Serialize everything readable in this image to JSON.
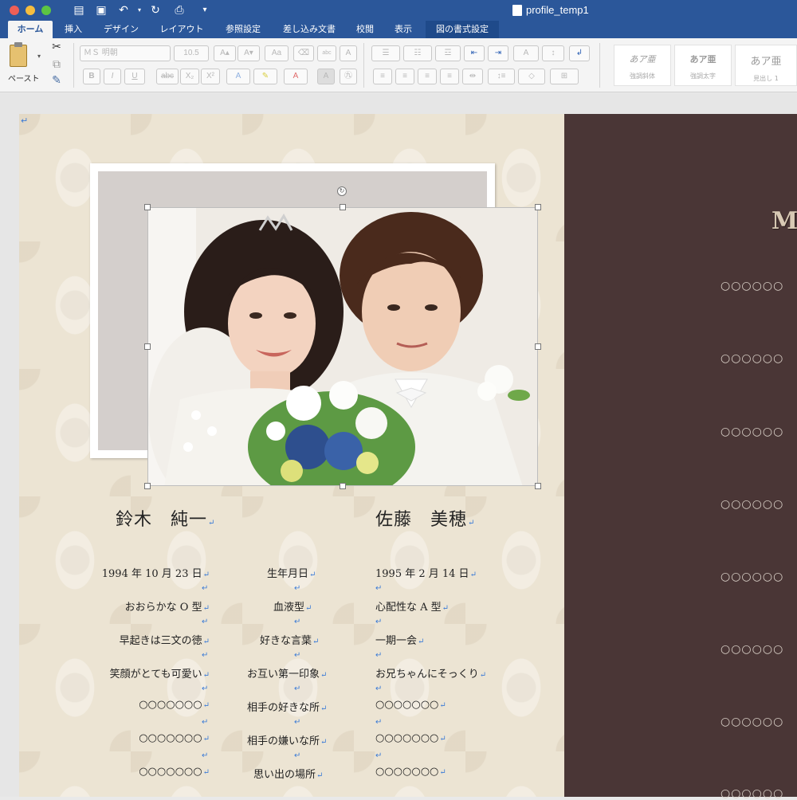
{
  "window": {
    "title": "profile_temp1"
  },
  "tabs": [
    "ホーム",
    "挿入",
    "デザイン",
    "レイアウト",
    "参照設定",
    "差し込み文書",
    "校閲",
    "表示",
    "図の書式設定"
  ],
  "ribbon": {
    "paste_label": "ペースト",
    "font_name": "ＭＳ 明朝",
    "font_size": "10.5",
    "bold": "B",
    "italic": "I",
    "underline": "U",
    "strike": "abc",
    "subscript": "X₂",
    "superscript": "X²",
    "styles": [
      {
        "sample": "あア亜",
        "name": "強調斜体"
      },
      {
        "sample": "あア亜",
        "name": "強調太字"
      },
      {
        "sample": "あア亜",
        "name": "見出し 1"
      }
    ]
  },
  "para_mark": "↵",
  "groom": {
    "name": "鈴木　純一",
    "birthday": "1994 年 10 月 23 日",
    "blood_type": "おおらかな O 型",
    "favorite_words": "早起きは三文の徳",
    "first_impression": "笑顔がとても可愛い",
    "likes": "○○○○○○○",
    "dislikes": "○○○○○○○",
    "memory_place": "○○○○○○○"
  },
  "labels": {
    "birthday": "生年月日",
    "blood_type": "血液型",
    "favorite_words": "好きな言葉",
    "first_impression": "お互い第一印象",
    "likes": "相手の好きな所",
    "dislikes": "相手の嫌いな所",
    "memory_place": "思い出の場所"
  },
  "bride": {
    "name": "佐藤　美穂",
    "birthday": "1995 年 2 月 14 日",
    "blood_type": "心配性な A 型",
    "favorite_words": "一期一会",
    "first_impression": "お兄ちゃんにそっくり",
    "likes": "○○○○○○○",
    "dislikes": "○○○○○○○",
    "memory_place": "○○○○○○○"
  },
  "right_page": {
    "title": "M",
    "lines": [
      "○○○○○○",
      "○○○○○○",
      "○○○○○○",
      "○○○○○○",
      "○○○○○○",
      "○○○○○○",
      "○○○○○○",
      "○○○○○○"
    ]
  }
}
